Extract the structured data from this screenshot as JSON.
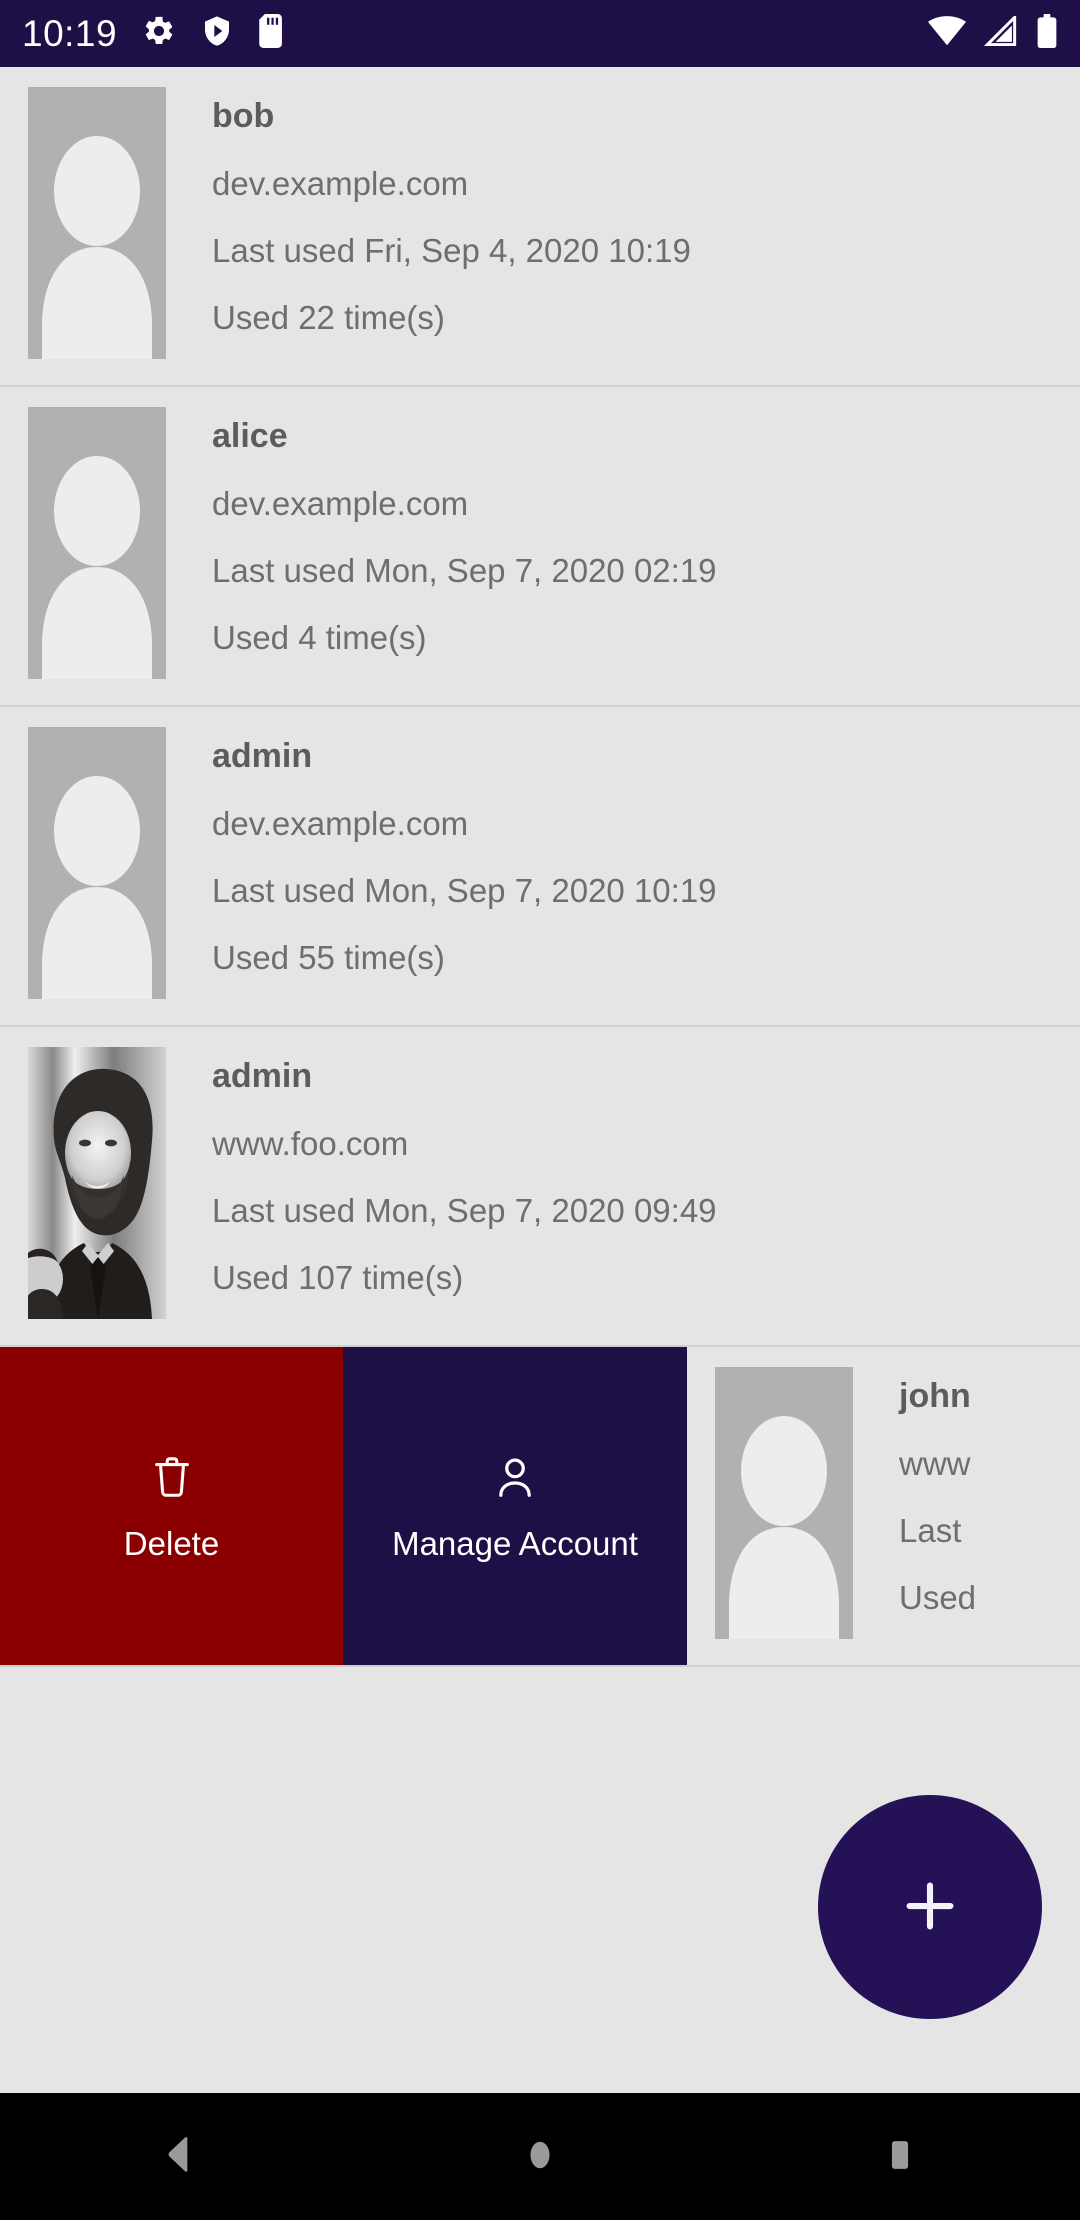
{
  "status_bar": {
    "clock": "10:19",
    "background_color": "#1E1046",
    "left_icons": [
      "gear-icon",
      "play-protect-shield-icon",
      "sd-card-icon"
    ],
    "right_icons": [
      "wifi-icon",
      "cell-signal-icon",
      "battery-icon"
    ]
  },
  "accounts": [
    {
      "username": "bob",
      "site": "dev.example.com",
      "last_used": "Last used Fri, Sep 4, 2020 10:19",
      "usage": "Used 22 time(s)",
      "avatar": "placeholder-person"
    },
    {
      "username": "alice",
      "site": "dev.example.com",
      "last_used": "Last used Mon, Sep 7, 2020 02:19",
      "usage": "Used 4 time(s)",
      "avatar": "placeholder-person"
    },
    {
      "username": "admin",
      "site": "dev.example.com",
      "last_used": "Last used Mon, Sep 7, 2020 10:19",
      "usage": "Used 55 time(s)",
      "avatar": "placeholder-person"
    },
    {
      "username": "admin",
      "site": "www.foo.com",
      "last_used": "Last used Mon, Sep 7, 2020 09:49",
      "usage": "Used 107 time(s)",
      "avatar": "photo"
    }
  ],
  "swiped_row": {
    "delete": {
      "label": "Delete",
      "icon": "trash-icon",
      "background_color": "#8A0000"
    },
    "manage": {
      "label": "Manage Account",
      "icon": "person-icon",
      "background_color": "#1E1046"
    },
    "peek_account": {
      "username": "john",
      "site": "www",
      "last_used": "Last",
      "usage": "Used",
      "avatar": "placeholder-person"
    }
  },
  "fab": {
    "icon": "plus-icon",
    "label": "+",
    "background_color": "#241156"
  },
  "nav_bar": {
    "buttons": [
      {
        "name": "back",
        "icon": "back-triangle-icon"
      },
      {
        "name": "home",
        "icon": "home-circle-icon"
      },
      {
        "name": "recents",
        "icon": "recents-square-icon"
      }
    ],
    "background_color": "#000000"
  },
  "colors": {
    "page_background": "#E5E5E5",
    "divider": "#CFCFCF",
    "avatar_background": "#B1B1B1",
    "avatar_person": "#EDEDED",
    "title_text": "#5C5C5C",
    "body_text": "#6E6E6E"
  }
}
